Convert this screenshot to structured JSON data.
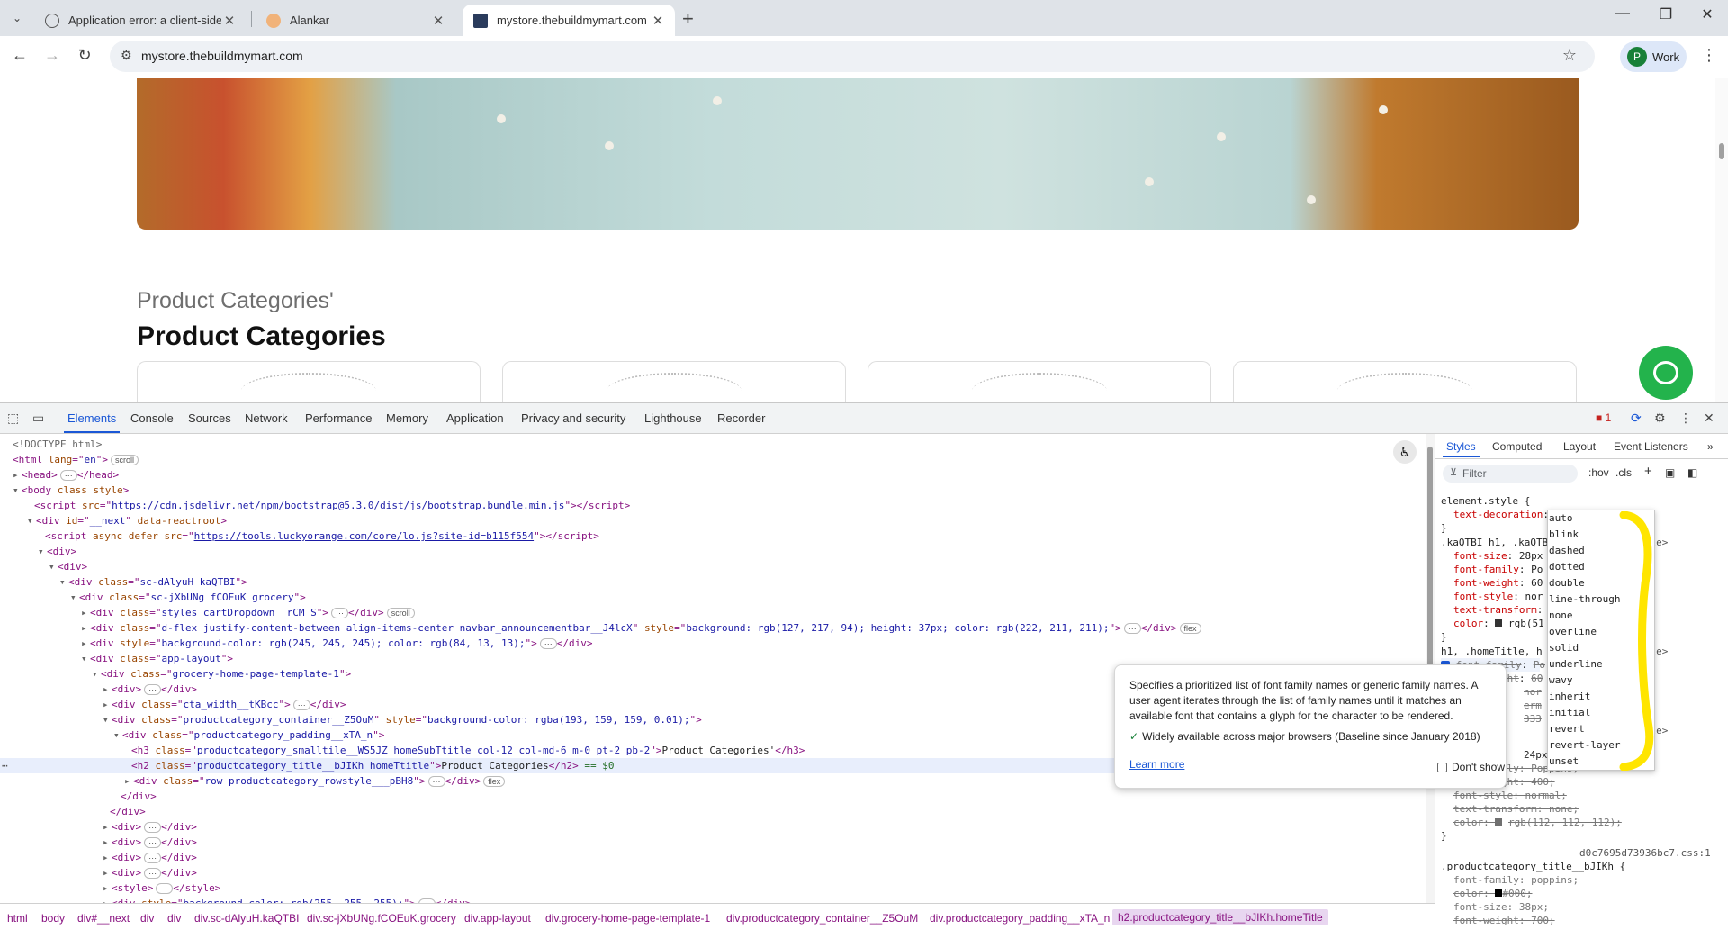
{
  "browser": {
    "tabs": [
      {
        "title": "Application error: a client-side exception has occurred",
        "active": false
      },
      {
        "title": "Alankar",
        "active": false
      },
      {
        "title": "mystore.thebuildmymart.com",
        "active": true
      }
    ],
    "new_tab": "+",
    "url": "mystore.thebuildmymart.com",
    "profile_initial": "P",
    "profile_label": "Work"
  },
  "page": {
    "category_subtitle": "Product Categories'",
    "category_title": "Product Categories"
  },
  "devtools": {
    "tabs": [
      "Elements",
      "Console",
      "Sources",
      "Network",
      "Performance",
      "Memory",
      "Application",
      "Privacy and security",
      "Lighthouse",
      "Recorder"
    ],
    "active_tab": "Elements",
    "error_count": "1",
    "breadcrumb": [
      "html",
      "body",
      "div#__next",
      "div",
      "div",
      "div.sc-dAlyuH.kaQTBI",
      "div.sc-jXbUNg.fCOEuK.grocery",
      "div.app-layout",
      "div.grocery-home-page-template-1",
      "div.productcategory_container__Z5OuM",
      "div.productcategory_padding__xTA_n",
      "h2.productcategory_title__bJIKh.homeTitle"
    ],
    "elements": {
      "doctype": "<!DOCTYPE html>",
      "html_lang": "en",
      "scroll": "scroll",
      "flex": "flex",
      "script1_src": "https://cdn.jsdelivr.net/npm/bootstrap@5.3.0/dist/js/bootstrap.bundle.min.js",
      "script2_src": "https://tools.luckyorange.com/core/lo.js?site-id=b115f554",
      "h3_text": "Product Categories'",
      "h2_text": "Product Categories",
      "eq": " == $0"
    },
    "styles": {
      "tabs": [
        "Styles",
        "Computed",
        "Layout",
        "Event Listeners"
      ],
      "active_tab": "Styles",
      "filter_placeholder": "Filter",
      "hov": ":hov",
      "cls": ".cls",
      "element_style": "element.style {",
      "editing_prop": "text-decoration",
      "style_tag": "<style>",
      "rule2_selector": ".kaQTBI h1, .kaQTB",
      "rule3_selector": "h1, .homeTitle, h",
      "rule4_source": "d0c7695d73936bc7.css:1",
      "rule4_selector": ".productcategory_title__bJIKh {",
      "rule2": [
        {
          "p": "font-size",
          "v": "28px"
        },
        {
          "p": "font-family",
          "v": "Po"
        },
        {
          "p": "font-weight",
          "v": "60"
        },
        {
          "p": "font-style",
          "v": "nor"
        },
        {
          "p": "text-transform",
          "v": ""
        },
        {
          "p": "color",
          "v": "rgb(51"
        }
      ],
      "rule3_partial": [
        {
          "p": "font-family",
          "v": "Po"
        },
        {
          "p": "font-weight",
          "v": "60"
        },
        {
          "p": "",
          "v": "nor"
        },
        {
          "p": "",
          "v": "erm"
        },
        {
          "p": "",
          "v": "333"
        }
      ],
      "rule_mid": [
        {
          "p": "",
          "v": "24px"
        },
        {
          "p": "",
          "v": "Poppins;"
        },
        {
          "p": "font-weight",
          "v": "400;"
        },
        {
          "p": "font-style",
          "v": "normal;"
        },
        {
          "p": "text-transform",
          "v": "none;"
        },
        {
          "p": "color",
          "v": "rgb(112, 112, 112);"
        }
      ],
      "rule4": [
        {
          "p": "font-family",
          "v": "poppins;"
        },
        {
          "p": "color",
          "v": "#000;"
        },
        {
          "p": "font-size",
          "v": "38px;"
        },
        {
          "p": "font-weight",
          "v": "700;"
        }
      ]
    },
    "autocomplete": [
      "auto",
      "blink",
      "dashed",
      "dotted",
      "double",
      "line-through",
      "none",
      "overline",
      "solid",
      "underline",
      "wavy",
      "inherit",
      "initial",
      "revert",
      "revert-layer",
      "unset"
    ],
    "tooltip": {
      "description": "Specifies a prioritized list of font family names or generic family names. A user agent iterates through the list of family names until it matches an available font that contains a glyph for the character to be rendered.",
      "baseline": "Widely available across major browsers (Baseline since January 2018)",
      "learn_more": "Learn more",
      "dont_show": "Don't show"
    }
  },
  "colors": {
    "accent": "#1a57d6",
    "chat": "#23b34c",
    "highlight": "#ffe500"
  }
}
